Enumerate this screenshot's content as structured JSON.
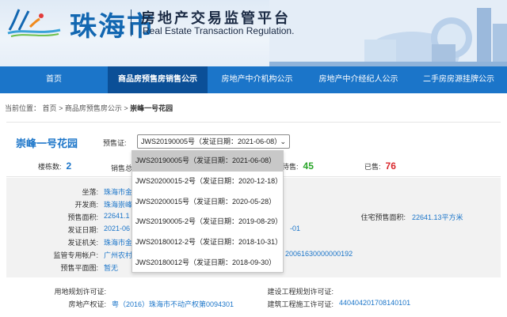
{
  "header": {
    "city_name": "珠海市",
    "title": "房地产交易监管平台",
    "subtitle": "Real Estate Transaction Regulation."
  },
  "nav": [
    {
      "label": "首页",
      "active": false
    },
    {
      "label": "商品房预售房销售公示",
      "active": true
    },
    {
      "label": "房地产中介机构公示",
      "active": false
    },
    {
      "label": "房地产中介经纪人公示",
      "active": false
    },
    {
      "label": "二手房房源挂牌公示",
      "active": false
    }
  ],
  "breadcrumb": {
    "prefix": "当前位置：",
    "home": "首页",
    "sep1": ">",
    "section": "商品房预售房公示",
    "sep2": ">",
    "current": "崇峰一号花园"
  },
  "project": {
    "name": "崇峰一号花园",
    "permit_label": "预售证:",
    "permit_selected": "JWS20190005号（发证日期：2021-06-08）"
  },
  "stats": {
    "buildings_label": "楼栋数:",
    "buildings_value": "2",
    "sales_label": "销售总",
    "pending_label": "待售:",
    "pending_value": "45",
    "sold_label": "已售:",
    "sold_value": "76",
    "colors": {
      "buildings": "#1b75c9",
      "pending": "#2aa52a",
      "sold": "#d9262b"
    }
  },
  "info": {
    "location_label": "坐落:",
    "location_value": "珠海市金",
    "developer_label": "开发商:",
    "developer_value": "珠海崇峰",
    "presale_area_label": "预售面积:",
    "presale_area_value": "22641.1",
    "issue_date_label": "发证日期:",
    "issue_date_value": "2021-06",
    "issue_date_tail": "-01",
    "issuer_label": "发证机关:",
    "issuer_value": "珠海市金",
    "account_label": "监管专用帐户:",
    "account_value": "广州农村",
    "account_tail": "20061630000000192",
    "floorplan_label": "预售平面图:",
    "floorplan_value": "暂无",
    "residential_area_label": "住宅预售面积:",
    "residential_area_value": "22641.13平方米"
  },
  "lower": {
    "land_permit_label": "用地规划许可证:",
    "land_permit_value": "",
    "construction_permit_label": "建设工程规划许可证:",
    "construction_permit_value": "",
    "property_cert_label": "房地产权证:",
    "property_cert_value": "粤（2016）珠海市不动产权第0094301",
    "build_permit_label": "建筑工程施工许可证:",
    "build_permit_value": "440404201708140101"
  },
  "dropdown": [
    "JWS20190005号（发证日期：2021-06-08）",
    "JWS20200015-2号（发证日期：2020-12-18）",
    "JWS20200015号（发证日期：2020-05-28）",
    "JWS20190005-2号（发证日期：2019-08-29）",
    "JWS20180012-2号（发证日期：2018-10-31）",
    "JWS20180012号（发证日期：2018-09-30）"
  ]
}
